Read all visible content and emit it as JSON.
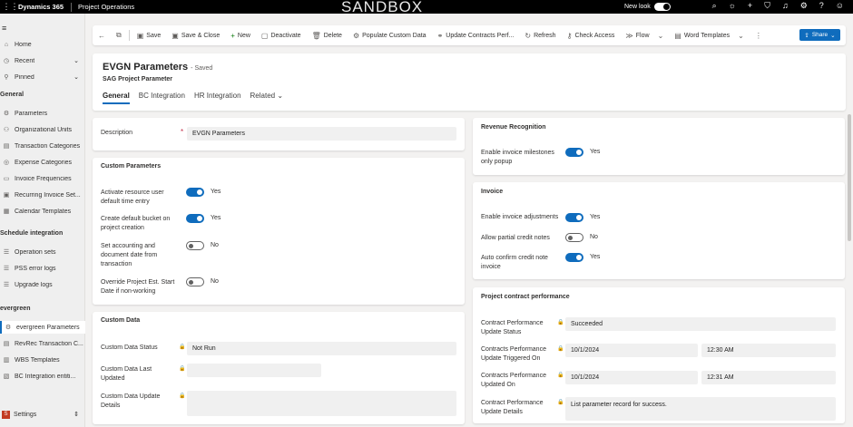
{
  "topbar": {
    "brand": "Dynamics 365",
    "app_name": "Project Operations",
    "environment": "SANDBOX",
    "new_look_label": "New look",
    "icons": [
      "search-icon",
      "lightbulb-icon",
      "plus-icon",
      "filter-icon",
      "bell-icon",
      "settings-icon",
      "help-icon",
      "account-icon"
    ]
  },
  "sidebar": {
    "items": [
      {
        "label": "Home",
        "icon": "home-icon"
      },
      {
        "label": "Recent",
        "icon": "recent-icon"
      },
      {
        "label": "Pinned",
        "icon": "pin-icon"
      }
    ],
    "groups": [
      {
        "title": "General",
        "items": [
          "Parameters",
          "Organizational Units",
          "Transaction Categories",
          "Expense Categories",
          "Invoice Frequencies",
          "Recurring Invoice Set...",
          "Calendar Templates"
        ]
      },
      {
        "title": "Schedule integration",
        "items": [
          "Operation sets",
          "PSS error logs",
          "Upgrade logs"
        ]
      },
      {
        "title": "evergreen",
        "items": [
          "evergreen Parameters",
          "RevRec Transaction C...",
          "WBS Templates",
          "BC Integration entiti..."
        ]
      }
    ],
    "settings": {
      "badge": "S",
      "label": "Settings"
    }
  },
  "commandbar": {
    "back": "back-icon",
    "popout": "popout-icon",
    "commands": [
      "Save",
      "Save & Close",
      "New",
      "Deactivate",
      "Delete",
      "Populate Custom Data",
      "Update Contracts Perf...",
      "Refresh",
      "Check Access",
      "Flow",
      "Word Templates"
    ],
    "share": "Share"
  },
  "record": {
    "title": "EVGN Parameters",
    "saved": "- Saved",
    "entity": "SAG Project Parameter",
    "tabs": [
      "General",
      "BC Integration",
      "HR Integration",
      "Related"
    ]
  },
  "description": {
    "label": "Description",
    "value": "EVGN Parameters"
  },
  "custom_parameters": {
    "title": "Custom Parameters",
    "fields": [
      {
        "label": "Activate resource user default time entry",
        "value": "Yes",
        "on": true
      },
      {
        "label": "Create default bucket on project creation",
        "value": "Yes",
        "on": true
      },
      {
        "label": "Set accounting and document date from transaction",
        "value": "No",
        "on": false
      },
      {
        "label": "Override Project Est. Start Date if non-working",
        "value": "No",
        "on": false
      }
    ]
  },
  "custom_data": {
    "title": "Custom Data",
    "status_label": "Custom Data Status",
    "status_value": "Not Run",
    "last_updated_label": "Custom Data Last Updated",
    "last_updated_value": "",
    "details_label": "Custom Data Update Details",
    "details_value": ""
  },
  "revenue": {
    "title": "Revenue Recognition",
    "fields": [
      {
        "label": "Enable invoice milestones only popup",
        "value": "Yes",
        "on": true
      }
    ]
  },
  "invoice": {
    "title": "Invoice",
    "fields": [
      {
        "label": "Enable invoice adjustments",
        "value": "Yes",
        "on": true
      },
      {
        "label": "Allow partial credit notes",
        "value": "No",
        "on": false
      },
      {
        "label": "Auto confirm credit note invoice",
        "value": "Yes",
        "on": true
      }
    ]
  },
  "contract_performance": {
    "title": "Project contract performance",
    "status_label": "Contract Performance Update Status",
    "status_value": "Succeeded",
    "triggered_label": "Contracts Performance Update Triggered On",
    "triggered_date": "10/1/2024",
    "triggered_time": "12:30 AM",
    "updated_label": "Contracts Performance Updated On",
    "updated_date": "10/1/2024",
    "updated_time": "12:31 AM",
    "details_label": "Contract Performance Update Details",
    "details_value": "List parameter record for success."
  }
}
